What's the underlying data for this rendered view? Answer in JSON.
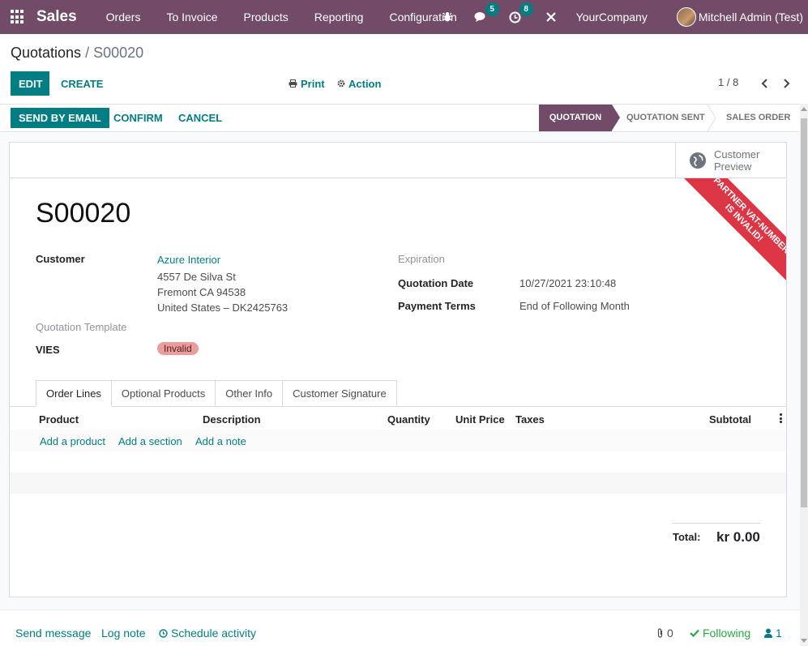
{
  "navbar": {
    "app_name": "Sales",
    "menu": [
      "Orders",
      "To Invoice",
      "Products",
      "Reporting",
      "Configuration"
    ],
    "messages_count": "5",
    "activities_count": "8",
    "company": "YourCompany",
    "user": "Mitchell Admin (Test)",
    "icons": [
      "apps-grid-icon",
      "bug-icon",
      "messages-icon",
      "activity-clock-icon",
      "tools-icon"
    ],
    "accent_color": "#714b67"
  },
  "breadcrumb": {
    "parent": "Quotations",
    "separator": "/",
    "current": "S00020"
  },
  "control": {
    "edit_label": "EDIT",
    "create_label": "CREATE",
    "print_label": "Print",
    "action_label": "Action",
    "pager": "1 / 8"
  },
  "statusbar": {
    "send_label": "SEND BY EMAIL",
    "confirm_label": "CONFIRM",
    "cancel_label": "CANCEL",
    "stages": [
      "QUOTATION",
      "QUOTATION SENT",
      "SALES ORDER"
    ],
    "current_stage": "QUOTATION"
  },
  "button_box": {
    "preview_line1": "Customer",
    "preview_line2": "Preview"
  },
  "ribbon": {
    "line1": "PARTNER VAT-NUMBER",
    "line2": "IS INVALID!",
    "color": "#dc3545"
  },
  "record": {
    "name": "S00020",
    "customer_label": "Customer",
    "customer_name": "Azure Interior",
    "address_line1": "4557 De Silva St",
    "address_line2": "Fremont CA 94538",
    "address_line3": "United States – DK2425763",
    "template_label": "Quotation Template",
    "vies_label": "VIES",
    "vies_value": "Invalid",
    "expiration_label": "Expiration",
    "quotation_date_label": "Quotation Date",
    "quotation_date": "10/27/2021 23:10:48",
    "payment_terms_label": "Payment Terms",
    "payment_terms": "End of Following Month"
  },
  "tabs": [
    "Order Lines",
    "Optional Products",
    "Other Info",
    "Customer Signature"
  ],
  "order_lines": {
    "columns": [
      "Product",
      "Description",
      "Quantity",
      "Unit Price",
      "Taxes",
      "Subtotal"
    ],
    "add_product": "Add a product",
    "add_section": "Add a section",
    "add_note": "Add a note"
  },
  "totals": {
    "label": "Total:",
    "value": "kr 0.00"
  },
  "chatter": {
    "send_message": "Send message",
    "log_note": "Log note",
    "schedule_activity": "Schedule activity",
    "attachments_count": "0",
    "following": "Following",
    "followers_count": "1"
  }
}
